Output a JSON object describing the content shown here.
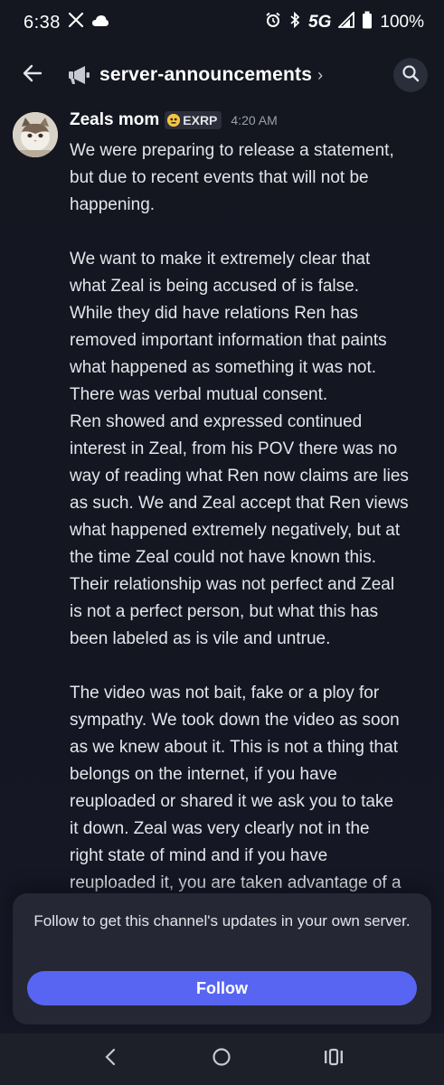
{
  "status_bar": {
    "time": "6:38",
    "network": "5G",
    "battery": "100%",
    "icons": [
      "x-logo-icon",
      "cloud-icon",
      "alarm-icon",
      "bluetooth-icon",
      "signal-icon",
      "battery-icon"
    ]
  },
  "header": {
    "channel_name": "server-announcements",
    "chevron": "›",
    "icons": [
      "back-arrow-icon",
      "megaphone-icon",
      "search-icon"
    ]
  },
  "message": {
    "author": "Zeals mom",
    "tag": "EXRP",
    "timestamp": "4:20 AM",
    "lines": [
      "We were preparing to release a statement,",
      "but due to recent events that will not be",
      "happening.",
      "",
      "We want to make it extremely clear that",
      "what Zeal is being accused of is false.",
      "While they did have relations Ren has",
      "removed important information that paints",
      "what happened as something it was not.",
      "There was verbal mutual consent.",
      "Ren showed and expressed continued",
      "interest in Zeal, from his POV there was no",
      "way of reading what Ren now claims are lies",
      "as such. We and Zeal accept that Ren views",
      "what happened extremely negatively, but at",
      "the time Zeal could not have known this.",
      "Their relationship was not perfect and Zeal",
      "is not a perfect person, but what this has",
      "been labeled as is vile and untrue.",
      "",
      "The video was not bait, fake or a ploy for",
      "sympathy. We took down the video as soon",
      "as we knew about it. This is not a thing that",
      "belongs on the internet, if you have",
      "reuploaded or shared it we ask you to take",
      "it down. Zeal was very clearly not in the",
      "right state of mind and if you have",
      "reuploaded it, you are taken advantage of a"
    ]
  },
  "follow_card": {
    "text": "Follow to get this channel's updates in your own server.",
    "button_label": "Follow"
  },
  "nav_bar": {
    "icons": [
      "nav-back-icon",
      "nav-home-icon",
      "nav-recents-icon"
    ]
  },
  "colors": {
    "background": "#151722",
    "accent": "#5865f2",
    "card": "#252834",
    "text": "#e3e5ea",
    "muted": "#9ba0ab"
  }
}
